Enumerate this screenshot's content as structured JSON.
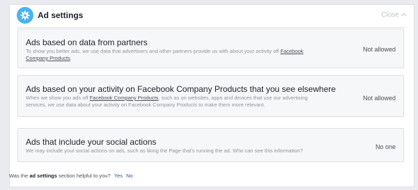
{
  "header": {
    "title": "Ad settings",
    "close_label": "Close",
    "icon": "gear-icon",
    "icon_color": "#4bb3f0"
  },
  "cards": [
    {
      "title": "Ads based on data from partners",
      "desc_before": "To show you better ads, we use data that advertisers and other partners provide us with about your activity off ",
      "desc_link": "Facebook Company Products",
      "desc_after": ".",
      "status": "Not allowed"
    },
    {
      "title": "Ads based on your activity on Facebook Company Products that you see elsewhere",
      "desc_before": "When we show you ads off ",
      "desc_link": "Facebook Company Products",
      "desc_after": ", such as on websites, apps and devices that use our advertising services, we use data about your activity on Facebook Company Products to make them more relevant.",
      "status": "Not allowed"
    },
    {
      "title": "Ads that include your social actions",
      "desc": "We may include your social actions on ads, such as liking the Page that's running the ad. Who can see this information?",
      "status": "No one"
    }
  ],
  "footer": {
    "prefix": "Was the",
    "section": "ad settings",
    "suffix": "section helpful to you?",
    "yes": "Yes",
    "no": "No"
  }
}
